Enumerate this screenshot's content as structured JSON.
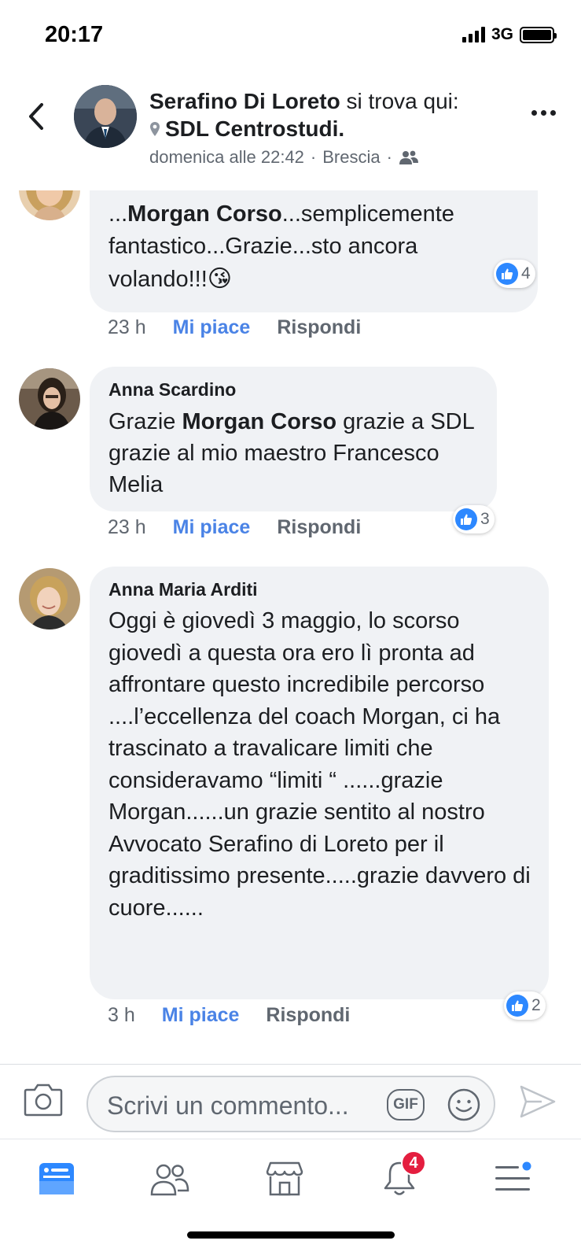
{
  "status_bar": {
    "time": "20:17",
    "network": "3G"
  },
  "header": {
    "author": "Serafino Di Loreto",
    "author_suffix": "si trova qui:",
    "place": "SDL Centrostudi.",
    "date": "domenica alle 22:42",
    "location": "Brescia",
    "separator": "·",
    "audience_icon": "friends-icon"
  },
  "comments": [
    {
      "author": "",
      "text_prefix": "...",
      "mention": "Morgan Corso",
      "text_suffix": "...semplicemente fantastico...Grazie...sto ancora volando!!!",
      "emoji": "😘",
      "time": "23 h",
      "like_label": "Mi piace",
      "reply_label": "Rispondi",
      "reaction_count": "4"
    },
    {
      "author": "Anna Scardino",
      "text_prefix": "Grazie ",
      "mention": "Morgan Corso",
      "text_suffix": " grazie a SDL grazie al mio maestro Francesco Melia",
      "time": "23 h",
      "like_label": "Mi piace",
      "reply_label": "Rispondi",
      "reaction_count": "3"
    },
    {
      "author": "Anna Maria Arditi",
      "text": "Oggi è giovedì 3 maggio, lo scorso giovedì a questa ora ero lì pronta ad affrontare questo incredibile percorso ....l’eccellenza del coach Morgan, ci ha trascinato a travalicare limiti che consideravamo “limiti “ ......grazie Morgan......un grazie sentito al nostro Avvocato Serafino di Loreto per il graditissimo presente.....grazie davvero di cuore......",
      "time": "3 h",
      "like_label": "Mi piace",
      "reply_label": "Rispondi",
      "reaction_count": "2"
    }
  ],
  "composer": {
    "placeholder": "Scrivi un commento...",
    "gif_label": "GIF"
  },
  "bottom_nav": {
    "items": [
      "news-feed-icon",
      "friends-icon",
      "marketplace-icon",
      "notifications-icon",
      "menu-icon"
    ],
    "notification_badge": "4"
  },
  "colors": {
    "link_blue": "#4a83e6",
    "like_blue": "#2d88ff",
    "bubble_gray": "#f0f2f5",
    "badge_red": "#e41e3f"
  }
}
